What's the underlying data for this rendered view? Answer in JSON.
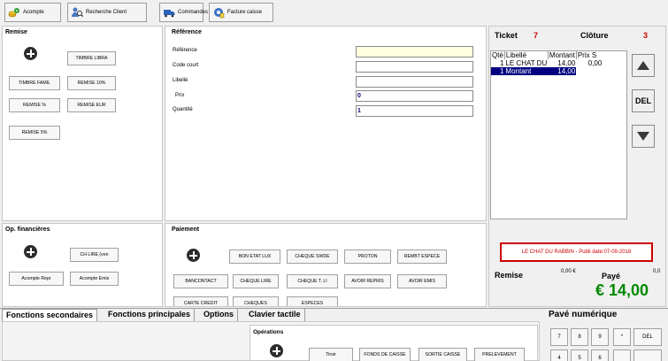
{
  "toolbar": {
    "acompte": "Acompte",
    "recherche_client": "Recherche Client",
    "commandes": "Commandes",
    "facture_caisse": "Facture caisse"
  },
  "remise": {
    "title": "Remise",
    "buttons": [
      "TIMBRE LIBRA",
      "TIMBRE FAMIL",
      "REMISE 10%",
      "REMISE %",
      "REMISE EUR",
      "REMISE 5%"
    ]
  },
  "reference": {
    "title": "Référence",
    "fields": [
      {
        "label": "Référence",
        "value": ""
      },
      {
        "label": "Code court",
        "value": ""
      },
      {
        "label": "Libellé",
        "value": ""
      },
      {
        "label": "Prix",
        "value": "0"
      },
      {
        "label": "Quantité",
        "value": "1"
      }
    ]
  },
  "ticket": {
    "label": "Ticket",
    "number": "7",
    "cloture_label": "Clôture",
    "cloture_number": "3",
    "columns": [
      "Qté",
      "Libellé",
      "Montant",
      "Prix S"
    ],
    "rows": [
      [
        "1",
        "LE CHAT DU",
        "14,00",
        "0,00"
      ],
      [
        "1",
        "Montant",
        "14,00",
        ""
      ]
    ],
    "del_label": "DEL"
  },
  "book_info": "LE CHAT DU RABBIN - Publi date:07-09-2018",
  "totals": {
    "remise_label": "Remise",
    "remise_value": "0,00 €",
    "paye_label": "Payé",
    "paye_value": "0,0",
    "total": "€ 14,00"
  },
  "financieres": {
    "title": "Op. financières",
    "buttons": [
      "CH LIRE (ven",
      "Acompte Repr",
      "Acompte Emis"
    ]
  },
  "paiement": {
    "title": "Paiement",
    "buttons": [
      "BON ETAT LUX",
      "CHEQUE SWDE",
      "PROTON",
      "REMBT ESPECE",
      "BANCONTACT",
      "CHEQUE LIRE",
      "CHEQUE T. LI",
      "AVOIR REPRIS",
      "AVOIR EMIS",
      "CARTE CREDIT",
      "CHEQUES",
      "ESPECES"
    ]
  },
  "tabs": [
    "Fonctions secondaires",
    "Fonctions principales",
    "Options",
    "Clavier tactile"
  ],
  "operations": {
    "title": "Opérations",
    "buttons": [
      "Tiroir",
      "FONDS DE CAISSE",
      "SORTIE CAISSE",
      "PRELEVEMENT"
    ]
  },
  "pave": {
    "title": "Pavé numérique",
    "keys": [
      "7",
      "8",
      "9",
      "*",
      "DEL",
      "4",
      "5",
      "6"
    ]
  },
  "colors": {
    "accent_red": "#cc0000",
    "total_green": "#008a00",
    "selection_blue": "#000080"
  }
}
